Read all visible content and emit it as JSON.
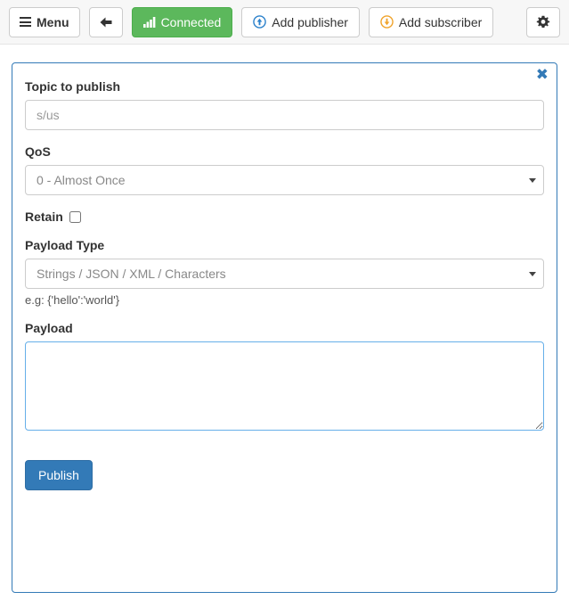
{
  "toolbar": {
    "menu_label": "Menu",
    "menu_icon": "hamburger-icon",
    "back_icon": "arrow-left-icon",
    "connected_label": "Connected",
    "connected_icon": "signal-bars-icon",
    "connected_color": "#5cb85c",
    "add_publisher_label": "Add publisher",
    "add_publisher_icon": "circle-arrow-up-icon",
    "add_publisher_icon_color": "#2b81cb",
    "add_subscriber_label": "Add subscriber",
    "add_subscriber_icon": "circle-arrow-down-icon",
    "add_subscriber_icon_color": "#f0a32a",
    "settings_icon": "gear-icon"
  },
  "panel": {
    "close_icon": "close-icon",
    "close_glyph": "✖",
    "border_color": "#337ab7",
    "topic": {
      "label": "Topic to publish",
      "value": "",
      "placeholder": "s/us"
    },
    "qos": {
      "label": "QoS",
      "selected": "0 - Almost Once",
      "caret_icon": "chevron-down-icon"
    },
    "retain": {
      "label": "Retain",
      "checked": false
    },
    "payload_type": {
      "label": "Payload Type",
      "selected": "Strings / JSON / XML / Characters",
      "help": "e.g: {'hello':'world'}",
      "caret_icon": "chevron-down-icon"
    },
    "payload": {
      "label": "Payload",
      "value": "",
      "placeholder": ""
    },
    "publish_label": "Publish",
    "publish_color": "#337ab7"
  }
}
